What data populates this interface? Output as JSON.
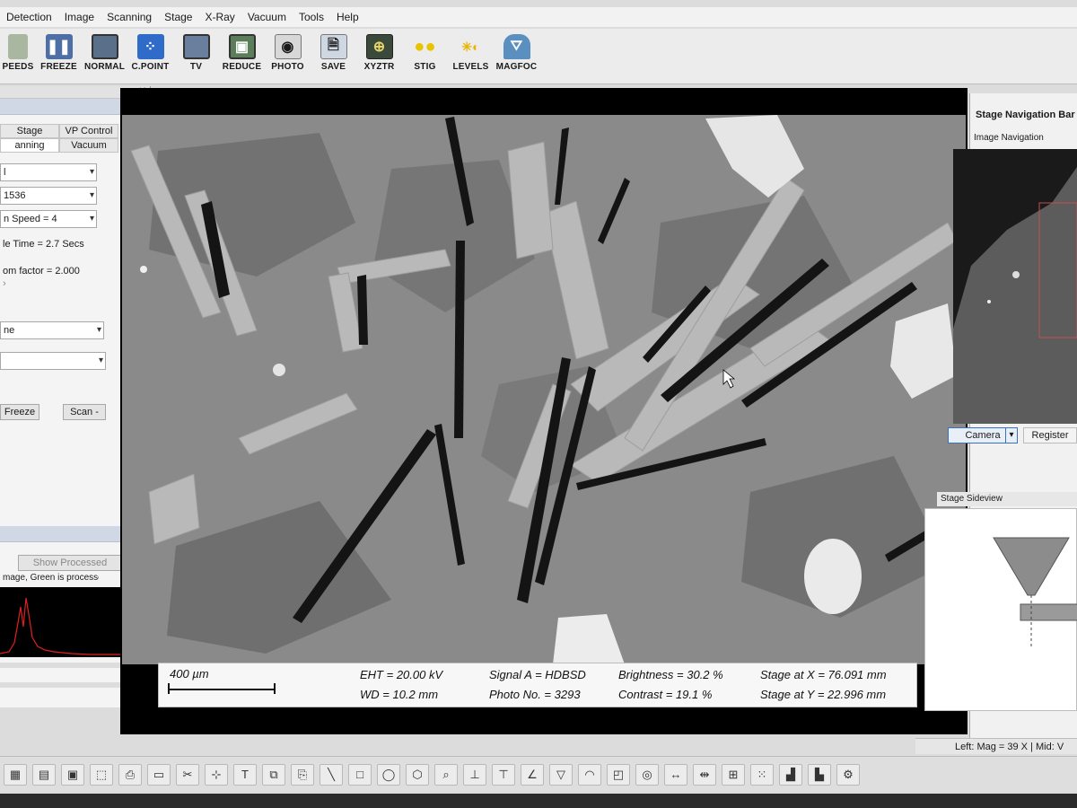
{
  "menu": [
    "Detection",
    "Image",
    "Scanning",
    "Stage",
    "X-Ray",
    "Vacuum",
    "Tools",
    "Help"
  ],
  "toolbar": [
    {
      "label": "PEEDS",
      "icon": "speeds-icon"
    },
    {
      "label": "FREEZE",
      "icon": "freeze-icon"
    },
    {
      "label": "NORMAL",
      "icon": "normal-icon"
    },
    {
      "label": "C.POINT",
      "icon": "cpoint-icon"
    },
    {
      "label": "TV",
      "icon": "tv-icon"
    },
    {
      "label": "REDUCE",
      "icon": "reduce-icon"
    },
    {
      "label": "PHOTO",
      "icon": "photo-icon"
    },
    {
      "label": "SAVE",
      "icon": "save-icon"
    },
    {
      "label": "XYZTR",
      "icon": "xyztr-icon"
    },
    {
      "label": "STIG",
      "icon": "stig-icon"
    },
    {
      "label": "LEVELS",
      "icon": "levels-icon"
    },
    {
      "label": "MAGFOC",
      "icon": "magfoc-icon"
    }
  ],
  "left_panel": {
    "tabs_row1": [
      "Stage",
      "VP Control"
    ],
    "tabs_row2": [
      "anning",
      "Vacuum"
    ],
    "fields": [
      {
        "value": "l",
        "dropdown": true
      },
      {
        "value": "1536",
        "dropdown": true
      },
      {
        "value": "n Speed = 4",
        "dropdown": true
      },
      {
        "value": "le Time = 2.7  Secs",
        "dropdown": false
      },
      {
        "value": "om factor =  2.000",
        "dropdown": false
      }
    ],
    "select1": "ne",
    "select2": "",
    "freeze_btn": "Freeze",
    "scan_btn": "Scan -",
    "show_processed": "Show Processed",
    "processed_note": "mage, Green is processed."
  },
  "databar": {
    "scale_label": "400 µm",
    "eht": "EHT = 20.00 kV",
    "wd": "WD = 10.2 mm",
    "signal": "Signal A = HDBSD",
    "photo_no": "Photo No.  = 3293",
    "brightness": "Brightness  =  30.2 %",
    "contrast": "Contrast  =  19.1 %",
    "stage_x": "Stage at X = 76.091 mm",
    "stage_y": "Stage at Y = 22.996 mm"
  },
  "right_panel": {
    "title": "Stage Navigation Bar",
    "image_nav": "Image Navigation",
    "camera_btn": "Camera",
    "register_btn": "Register",
    "sideview": "Stage Sideview"
  },
  "status": {
    "mag": "Left: Mag =    39 X | Mid: V"
  },
  "colors": {
    "accent": "#3a6fc4",
    "image_bg": "#8e8e8e",
    "histogram_line": "#e02020"
  }
}
